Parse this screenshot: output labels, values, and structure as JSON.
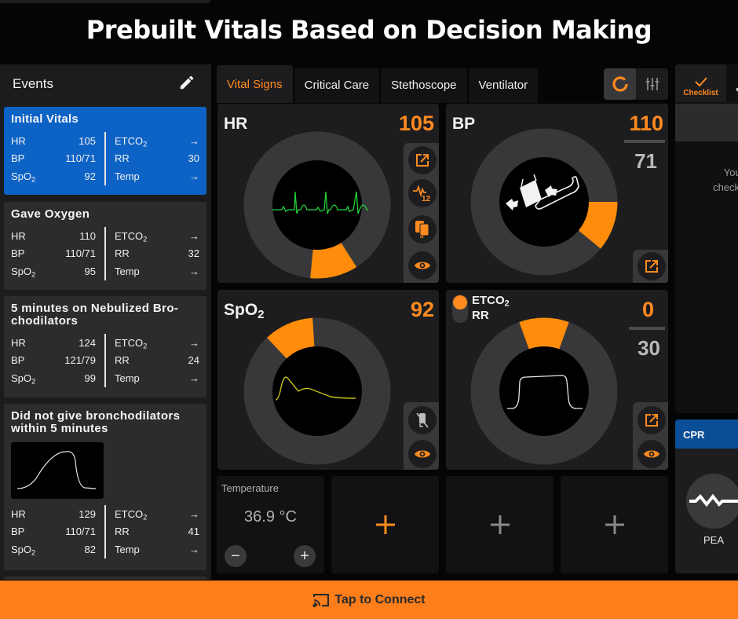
{
  "banner": {
    "title": "Prebuilt Vitals Based on Decision Making"
  },
  "sidebar": {
    "title": "Events",
    "edit_icon": "pencil-icon",
    "events": [
      {
        "title": "Initial Vitals",
        "active": true,
        "left": [
          {
            "label": "HR",
            "value": "105"
          },
          {
            "label": "BP",
            "value": "110/71"
          },
          {
            "label": "SpO",
            "sub": "2",
            "value": "92"
          }
        ],
        "right": [
          {
            "label": "ETCO",
            "sub": "2",
            "value": "→"
          },
          {
            "label": "RR",
            "value": "30"
          },
          {
            "label": "Temp",
            "value": "→"
          }
        ]
      },
      {
        "title": "Gave Oxygen",
        "active": false,
        "left": [
          {
            "label": "HR",
            "value": "110"
          },
          {
            "label": "BP",
            "value": "110/71"
          },
          {
            "label": "SpO",
            "sub": "2",
            "value": "95"
          }
        ],
        "right": [
          {
            "label": "ETCO",
            "sub": "2",
            "value": "→"
          },
          {
            "label": "RR",
            "value": "32"
          },
          {
            "label": "Temp",
            "value": "→"
          }
        ]
      },
      {
        "title": "5 minutes on Nebulized Bro-chodilators",
        "active": false,
        "left": [
          {
            "label": "HR",
            "value": "124"
          },
          {
            "label": "BP",
            "value": "121/79"
          },
          {
            "label": "SpO",
            "sub": "2",
            "value": "99"
          }
        ],
        "right": [
          {
            "label": "ETCO",
            "sub": "2",
            "value": "→"
          },
          {
            "label": "RR",
            "value": "24"
          },
          {
            "label": "Temp",
            "value": "→"
          }
        ]
      },
      {
        "title": "Did not give bronchodilators within 5 minutes",
        "active": false,
        "has_waveform": true,
        "left": [
          {
            "label": "HR",
            "value": "129"
          },
          {
            "label": "BP",
            "value": "110/71"
          },
          {
            "label": "SpO",
            "sub": "2",
            "value": "82"
          }
        ],
        "right": [
          {
            "label": "ETCO",
            "sub": "2",
            "value": "→"
          },
          {
            "label": "RR",
            "value": "41"
          },
          {
            "label": "Temp",
            "value": "→"
          }
        ]
      }
    ]
  },
  "tabs": [
    {
      "label": "Vital Signs",
      "active": true
    },
    {
      "label": "Critical Care",
      "active": false
    },
    {
      "label": "Stethoscope",
      "active": false
    },
    {
      "label": "Ventilator",
      "active": false
    }
  ],
  "view_toggle": {
    "options": [
      "ring-view-icon",
      "sliders-icon"
    ],
    "selected": "ring-view-icon"
  },
  "vitals": {
    "hr": {
      "label": "HR",
      "value": "105",
      "gauge_fraction": 0.105,
      "icons": [
        "external-link-icon",
        "ecg-12-lead-icon",
        "pads-icon",
        "eye-icon"
      ]
    },
    "bp": {
      "label": "BP",
      "systolic": "110",
      "diastolic": "71",
      "gauge_fraction": 0.11,
      "icons": [
        "external-link-icon"
      ]
    },
    "spo2": {
      "label": "SpO",
      "label_sub": "2",
      "value": "92",
      "gauge_fraction": 0.11,
      "icons": [
        "sensor-off-icon",
        "eye-icon"
      ]
    },
    "etco2": {
      "label": "ETCO",
      "label_sub": "2",
      "label2": "RR",
      "value": "0",
      "secondary": "30",
      "gauge_fraction": 0.11,
      "icons": [
        "external-link-icon",
        "eye-icon"
      ]
    }
  },
  "temperature": {
    "label": "Temperature",
    "value": "36.9 °C",
    "decrement": "−",
    "increment": "+"
  },
  "add_slots": [
    {
      "icon": "plus-icon",
      "color": "#ff8a1f"
    },
    {
      "icon": "plus-icon",
      "color": "#8a8a8c"
    },
    {
      "icon": "plus-icon",
      "color": "#8a8a8c"
    }
  ],
  "right_panel": {
    "checklist_tab": "Checklist",
    "checklist_text_line1": "Your Ch",
    "checklist_text_line2": "checklist",
    "cpr_title": "CPR",
    "rhythm_label": "PEA"
  },
  "footer": {
    "label": "Tap to Connect",
    "icon": "cast-icon"
  },
  "colors": {
    "accent": "#ff8a1f",
    "active_event": "#0d62c5",
    "cpr_header": "#0a4e98",
    "footer": "#fd7e1a",
    "ecg": "#1fd23a",
    "pleth": "#c8c21a"
  }
}
